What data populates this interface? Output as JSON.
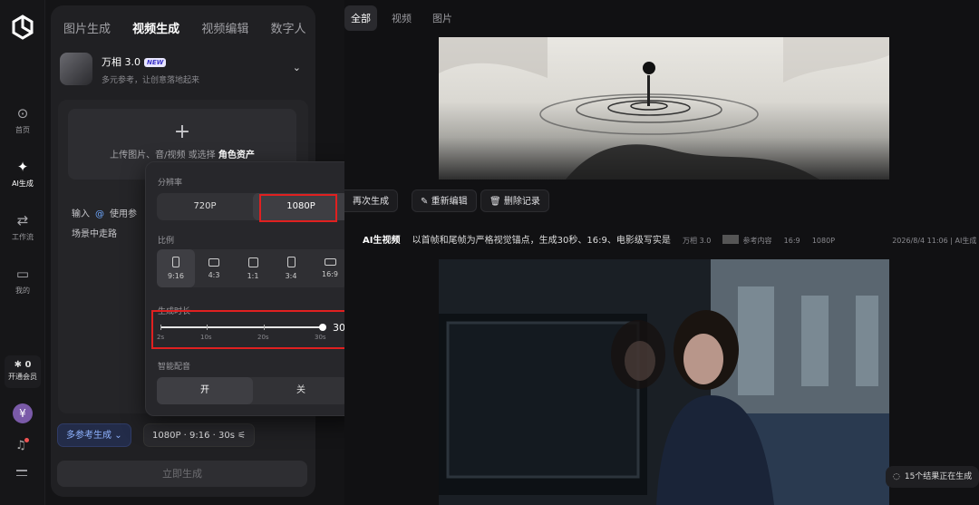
{
  "rail": {
    "items": [
      {
        "label": "首页",
        "icon": "compass-icon"
      },
      {
        "label": "AI生成",
        "icon": "sparkle-icon"
      },
      {
        "label": "工作流",
        "icon": "workflow-icon"
      },
      {
        "label": "我的",
        "icon": "folder-icon"
      }
    ],
    "vip_count": "0",
    "vip_label": "开通会员",
    "avatar_letter": "¥"
  },
  "panel": {
    "tabs": [
      "图片生成",
      "视频生成",
      "视频编辑",
      "数字人"
    ],
    "active_tab": "视频生成",
    "model_name": "万相 3.0",
    "model_badge": "NEW",
    "model_subtitle": "多元参考，让创意落地起来",
    "upload_text": "上传图片、音/视频 或选择",
    "upload_link": "角色资产",
    "prompt_prefix": "输入",
    "prompt_at": "@",
    "prompt_use": "使用参",
    "prompt_line2": "场景中走路",
    "mode_chip": "多参考生成",
    "settings_chip": "1080P · 9:16 · 30s",
    "generate_button": "立即生成"
  },
  "popup": {
    "resolution_label": "分辨率",
    "resolutions": [
      "720P",
      "1080P"
    ],
    "selected_resolution": "1080P",
    "ratio_label": "比例",
    "ratios": [
      "9:16",
      "4:3",
      "1:1",
      "3:4",
      "16:9"
    ],
    "selected_ratio": "9:16",
    "duration_label": "生成时长",
    "duration_ticks": [
      "2s",
      "10s",
      "20s",
      "30s"
    ],
    "duration_value": "30s",
    "duration_level": 1.0,
    "audio_label": "智能配音",
    "audio_options": [
      "开",
      "关"
    ],
    "selected_audio": "开"
  },
  "right": {
    "filter_tabs": [
      "全部",
      "视频",
      "图片"
    ],
    "active_filter": "全部",
    "actions": [
      "再次生成",
      "重新编辑",
      "删除记录"
    ],
    "record_tag": "AI生视频",
    "record_prompt": "以首帧和尾帧为严格视觉锚点，生成30秒、16:9、电影级写实是",
    "record_model": "万相 3.0",
    "record_ref": "参考内容",
    "record_ratio": "16:9",
    "record_res": "1080P",
    "record_time": "2026/8/4 11:06 | AI生成",
    "progress_text": "15个结果正在生成"
  },
  "colors": {
    "accent": "#8fb3ff",
    "highlight_box": "#e02020",
    "badge": "#3b34c8"
  }
}
